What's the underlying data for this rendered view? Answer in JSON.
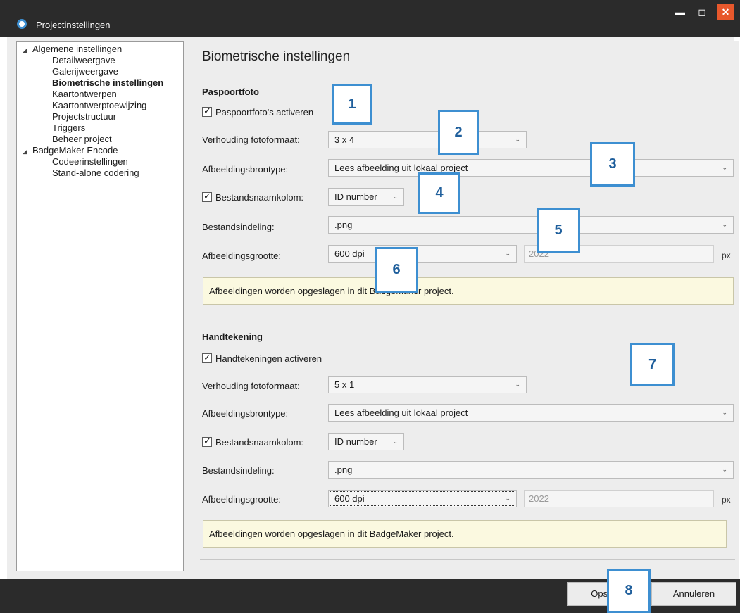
{
  "window": {
    "title": "Projectinstellingen"
  },
  "tree": {
    "groups": [
      {
        "label": "Algemene instellingen",
        "children": [
          "Detailweergave",
          "Galerijweergave",
          "Biometrische instellingen",
          "Kaartontwerpen",
          "Kaartontwerptoewijzing",
          "Projectstructuur",
          "Triggers",
          "Beheer project"
        ]
      },
      {
        "label": "BadgeMaker Encode",
        "children": [
          "Codeerinstellingen",
          "Stand-alone codering"
        ]
      }
    ],
    "selected": "Biometrische instellingen"
  },
  "page": {
    "title": "Biometrische instellingen"
  },
  "passport": {
    "heading": "Paspoortfoto",
    "enable_label": "Paspoortfoto's activeren",
    "ratio_label": "Verhouding fotoformaat:",
    "ratio_value": "3 x 4",
    "source_label": "Afbeeldingsbrontype:",
    "source_value": "Lees afbeelding uit lokaal project",
    "filename_label": "Bestandsnaamkolom:",
    "filename_value": "ID number",
    "format_label": "Bestandsindeling:",
    "format_value": ".png",
    "size_label": "Afbeeldingsgrootte:",
    "size_value": "600 dpi",
    "size_px": "2022",
    "size_unit": "px",
    "info": "Afbeeldingen worden opgeslagen in dit BadgeMaker project."
  },
  "signature": {
    "heading": "Handtekening",
    "enable_label": "Handtekeningen activeren",
    "ratio_label": "Verhouding fotoformaat:",
    "ratio_value": "5 x 1",
    "source_label": "Afbeeldingsbrontype:",
    "source_value": "Lees afbeelding uit lokaal project",
    "filename_label": "Bestandsnaamkolom:",
    "filename_value": "ID number",
    "format_label": "Bestandsindeling:",
    "format_value": ".png",
    "size_label": "Afbeeldingsgrootte:",
    "size_value": "600 dpi",
    "size_px": "2022",
    "size_unit": "px",
    "info": "Afbeeldingen worden opgeslagen in dit BadgeMaker project."
  },
  "buttons": {
    "save": "Opslaan",
    "cancel": "Annuleren"
  },
  "callouts": [
    "1",
    "2",
    "3",
    "4",
    "5",
    "6",
    "7",
    "8"
  ],
  "colors": {
    "accent": "#3d8fd1",
    "close": "#e8582c",
    "chrome": "#2b2b2b",
    "info_bg": "#fbf9e0"
  }
}
